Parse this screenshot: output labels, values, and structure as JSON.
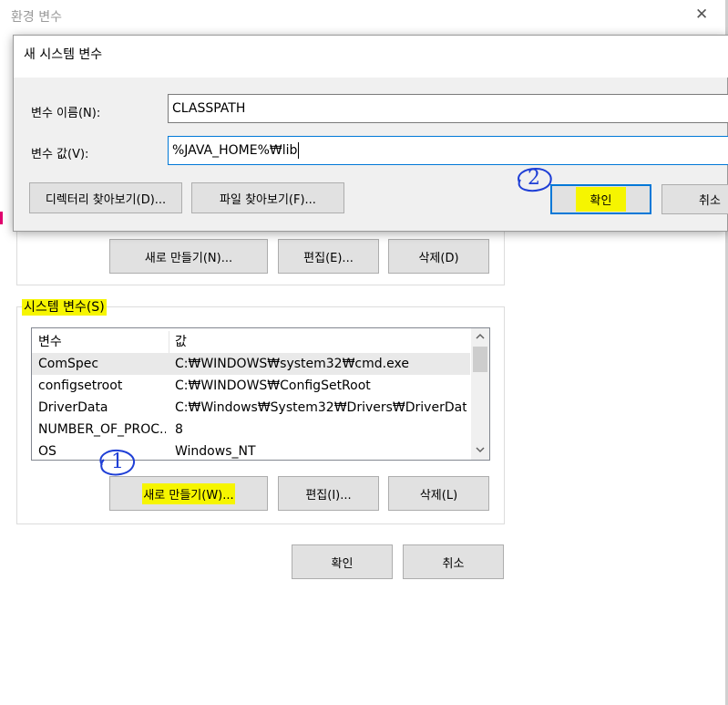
{
  "bg_window": {
    "title": "환경 변수",
    "close_glyph": "✕"
  },
  "dialog": {
    "title": "새 시스템 변수",
    "name_label": "변수 이름(N):",
    "name_value": "CLASSPATH",
    "value_label": "변수 값(V):",
    "value_value": "%JAVA_HOME%₩lib",
    "browse_dir_label": "디렉터리 찾아보기(D)...",
    "browse_file_label": "파일 찾아보기(F)...",
    "ok_label": "확인",
    "cancel_label": "취소",
    "annotation": "2"
  },
  "user_vars": {
    "new_label": "새로 만들기(N)...",
    "edit_label": "편집(E)...",
    "delete_label": "삭제(D)"
  },
  "system_vars": {
    "title": "시스템 변수(S)",
    "headers": [
      "변수",
      "값"
    ],
    "rows": [
      {
        "name": "ComSpec",
        "value": "C:₩WINDOWS₩system32₩cmd.exe"
      },
      {
        "name": "configsetroot",
        "value": "C:₩WINDOWS₩ConfigSetRoot"
      },
      {
        "name": "DriverData",
        "value": "C:₩Windows₩System32₩Drivers₩DriverData"
      },
      {
        "name": "NUMBER_OF_PROC...",
        "value": "8"
      },
      {
        "name": "OS",
        "value": "Windows_NT"
      }
    ],
    "new_label": "새로 만들기(W)...",
    "edit_label": "편집(I)...",
    "delete_label": "삭제(L)",
    "annotation": "1"
  },
  "footer": {
    "ok_label": "확인",
    "cancel_label": "취소"
  },
  "colors": {
    "highlight": "#f6f500",
    "annotation_ink": "#1f3fd6",
    "focus_border": "#0078d7",
    "button_bg": "#e1e1e1"
  }
}
